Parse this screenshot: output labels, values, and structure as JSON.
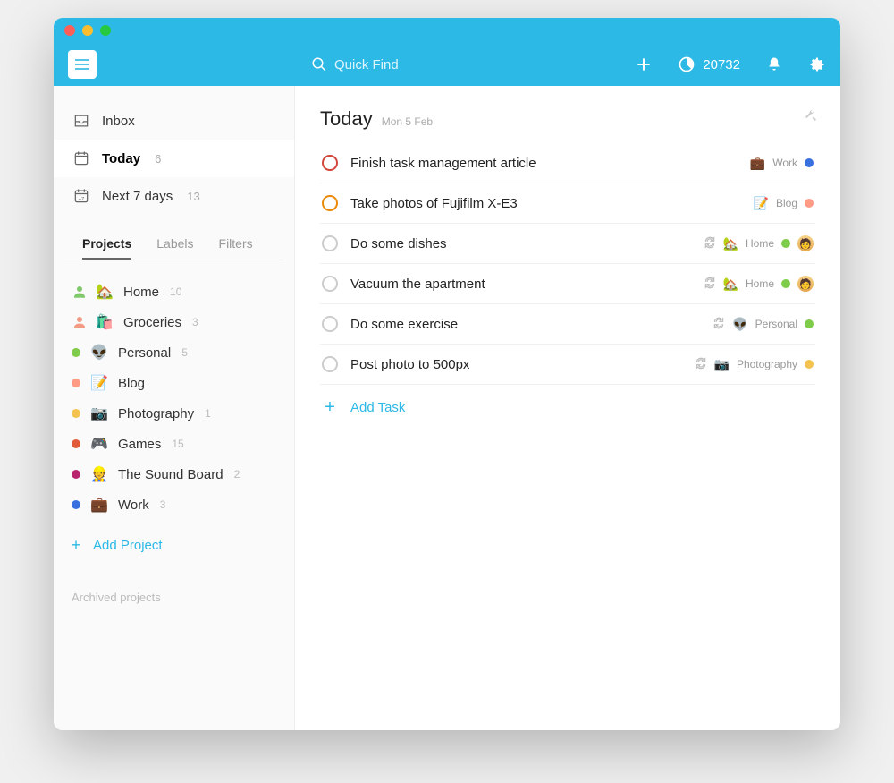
{
  "header": {
    "search_placeholder": "Quick Find",
    "karma_points": "20732"
  },
  "sidebar": {
    "nav": [
      {
        "label": "Inbox",
        "count": "",
        "key": "inbox"
      },
      {
        "label": "Today",
        "count": "6",
        "key": "today"
      },
      {
        "label": "Next 7 days",
        "count": "13",
        "key": "next7"
      }
    ],
    "tabs": {
      "projects": "Projects",
      "labels": "Labels",
      "filters": "Filters"
    },
    "projects": [
      {
        "shared": true,
        "share_color": "#7fc96b",
        "dot": "",
        "emoji": "🏡",
        "name": "Home",
        "count": "10"
      },
      {
        "shared": true,
        "share_color": "#f29a84",
        "dot": "",
        "emoji": "🛍️",
        "name": "Groceries",
        "count": "3"
      },
      {
        "shared": false,
        "dot": "#7ecc49",
        "emoji": "👽",
        "name": "Personal",
        "count": "5"
      },
      {
        "shared": false,
        "dot": "#ff9a85",
        "emoji": "📝",
        "name": "Blog",
        "count": ""
      },
      {
        "shared": false,
        "dot": "#f3c24f",
        "emoji": "📷",
        "name": "Photography",
        "count": "1"
      },
      {
        "shared": false,
        "dot": "#e05b3a",
        "emoji": "🎮",
        "name": "Games",
        "count": "15"
      },
      {
        "shared": false,
        "dot": "#b8256f",
        "emoji": "👷",
        "name": "The Sound Board",
        "count": "2"
      },
      {
        "shared": false,
        "dot": "#3870e0",
        "emoji": "💼",
        "name": "Work",
        "count": "3"
      }
    ],
    "add_project": "Add Project",
    "archived": "Archived projects"
  },
  "main": {
    "title": "Today",
    "date": "Mon 5 Feb",
    "tasks": [
      {
        "priority": "p1",
        "title": "Finish task management article",
        "repeat": false,
        "project": {
          "emoji": "💼",
          "name": "Work",
          "color": "#3870e0"
        },
        "assigned": false
      },
      {
        "priority": "p2",
        "title": "Take photos of Fujifilm X-E3",
        "repeat": false,
        "project": {
          "emoji": "📝",
          "name": "Blog",
          "color": "#ff9a85"
        },
        "assigned": false
      },
      {
        "priority": "",
        "title": "Do some dishes",
        "repeat": true,
        "project": {
          "emoji": "🏡",
          "name": "Home",
          "color": "#7ecc49"
        },
        "assigned": true
      },
      {
        "priority": "",
        "title": "Vacuum the apartment",
        "repeat": true,
        "project": {
          "emoji": "🏡",
          "name": "Home",
          "color": "#7ecc49"
        },
        "assigned": true
      },
      {
        "priority": "",
        "title": "Do some exercise",
        "repeat": true,
        "project": {
          "emoji": "👽",
          "name": "Personal",
          "color": "#7ecc49"
        },
        "assigned": false
      },
      {
        "priority": "",
        "title": "Post photo to 500px",
        "repeat": true,
        "project": {
          "emoji": "📷",
          "name": "Photography",
          "color": "#f3c24f"
        },
        "assigned": false
      }
    ],
    "add_task": "Add Task"
  }
}
